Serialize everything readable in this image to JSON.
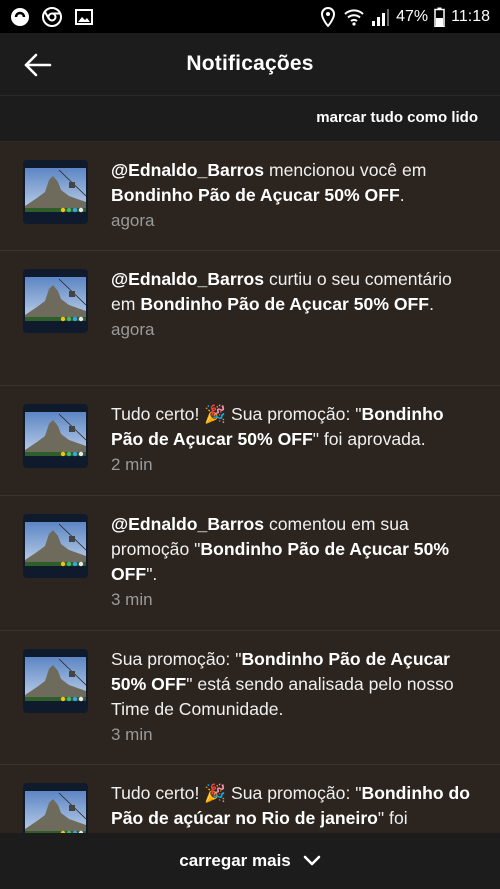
{
  "status_bar": {
    "battery": "47%",
    "time": "11:18"
  },
  "header": {
    "title": "Notificações"
  },
  "actions": {
    "mark_all_read": "marcar tudo como lido"
  },
  "notifications": [
    {
      "user": "@Ednaldo_Barros",
      "text": " mencionou você em ",
      "promo": "Bondinho Pão de Açucar 50% OFF",
      "suffix": ".",
      "time": "agora"
    },
    {
      "user": "@Ednaldo_Barros",
      "text": " curtiu o seu comentário em ",
      "promo": "Bondinho Pão de Açucar 50% OFF",
      "suffix": ".",
      "time": "agora"
    },
    {
      "prefix": "Tudo certo! 🎉 Sua promoção: \"",
      "promo": "Bondinho Pão de Açucar 50% OFF",
      "suffix": "\" foi aprovada.",
      "time": "2 min"
    },
    {
      "user": "@Ednaldo_Barros",
      "text": " comentou em sua promoção \"",
      "promo": "Bondinho Pão de Açucar 50% OFF",
      "suffix": "\".",
      "time": "3 min"
    },
    {
      "prefix": "Sua promoção: \"",
      "promo": "Bondinho Pão de Açucar 50% OFF",
      "suffix": "\" está sendo analisada pelo nosso Time de Comunidade.",
      "time": "3 min"
    },
    {
      "prefix": "Tudo certo! 🎉 Sua promoção: \"",
      "promo": "Bondinho do Pão de açúcar no Rio de janeiro",
      "suffix": "\" foi",
      "time": ""
    }
  ],
  "footer": {
    "load_more": "carregar mais"
  }
}
